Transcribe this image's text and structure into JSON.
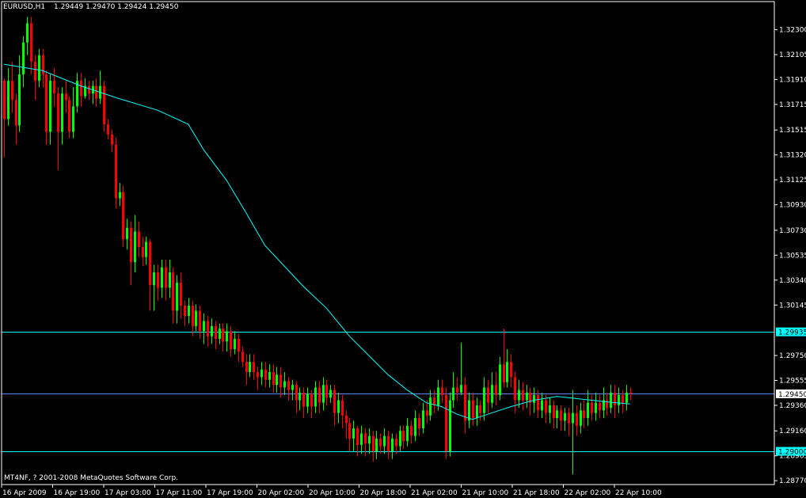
{
  "header": {
    "symbol": "EURUSD,H1",
    "ohlc": "1.29449 1.29470 1.29424 1.29450"
  },
  "footer": {
    "copyright": "MT4NF, ? 2001-2008 MetaQuotes Software Corp."
  },
  "colors": {
    "background": "#000000",
    "frame": "#ffffff",
    "bull": "#00ff00",
    "bear": "#ff0000",
    "ma": "#00ffff",
    "level_line": "#00ffff",
    "bid_line": "#5f7fff"
  },
  "chart_data": {
    "type": "candlestick",
    "symbol": "EURUSD",
    "timeframe": "H1",
    "ylim": [
      1.2874,
      1.3252
    ],
    "y_ticks": [
      "1.32300",
      "1.32105",
      "1.31910",
      "1.31715",
      "1.31515",
      "1.31320",
      "1.31125",
      "1.30930",
      "1.30730",
      "1.30535",
      "1.30340",
      "1.30145",
      "1.29935",
      "1.29750",
      "1.29555",
      "1.29450",
      "1.29360",
      "1.29160",
      "1.29000",
      "1.28965",
      "1.28770"
    ],
    "x_ticks": [
      "16 Apr 2009",
      "16 Apr 19:00",
      "17 Apr 03:00",
      "17 Apr 11:00",
      "17 Apr 19:00",
      "20 Apr 02:00",
      "20 Apr 10:00",
      "20 Apr 18:00",
      "21 Apr 02:00",
      "21 Apr 10:00",
      "21 Apr 18:00",
      "22 Apr 02:00",
      "22 Apr 10:00"
    ],
    "highlight_levels": [
      {
        "label": "1.29935",
        "value": 1.29935,
        "color": "#00ffff"
      },
      {
        "label": "1.29450",
        "value": 1.2945,
        "color": "#5f7fff"
      },
      {
        "label": "1.29000",
        "value": 1.29,
        "color": "#00ffff"
      }
    ],
    "ma_points": [
      [
        0,
        1.3203
      ],
      [
        10,
        1.3198
      ],
      [
        20,
        1.3186
      ],
      [
        30,
        1.3176
      ],
      [
        40,
        1.3167
      ],
      [
        48,
        1.3156
      ],
      [
        52,
        1.3136
      ],
      [
        58,
        1.3112
      ],
      [
        63,
        1.3087
      ],
      [
        68,
        1.3061
      ],
      [
        73,
        1.3045
      ],
      [
        78,
        1.3029
      ],
      [
        84,
        1.3012
      ],
      [
        90,
        1.299
      ],
      [
        95,
        1.2975
      ],
      [
        100,
        1.296
      ],
      [
        105,
        1.2948
      ],
      [
        110,
        1.2938
      ],
      [
        114,
        1.2935
      ],
      [
        118,
        1.2929
      ],
      [
        122,
        1.2925
      ],
      [
        126,
        1.2929
      ],
      [
        132,
        1.2935
      ],
      [
        138,
        1.294
      ],
      [
        144,
        1.2943
      ],
      [
        150,
        1.2941
      ],
      [
        156,
        1.2939
      ],
      [
        163,
        1.2937
      ]
    ],
    "candles": [
      [
        1.319,
        1.316,
        1.3192,
        1.313
      ],
      [
        1.316,
        1.319,
        1.32,
        1.3155
      ],
      [
        1.319,
        1.3175,
        1.3205,
        1.3165
      ],
      [
        1.3175,
        1.3155,
        1.318,
        1.314
      ],
      [
        1.3155,
        1.3195,
        1.321,
        1.315
      ],
      [
        1.3195,
        1.322,
        1.3225,
        1.3185
      ],
      [
        1.322,
        1.3235,
        1.324,
        1.321
      ],
      [
        1.3235,
        1.3205,
        1.324,
        1.3195
      ],
      [
        1.3205,
        1.319,
        1.321,
        1.3175
      ],
      [
        1.319,
        1.321,
        1.3215,
        1.3185
      ],
      [
        1.321,
        1.3195,
        1.3215,
        1.3185
      ],
      [
        1.3195,
        1.315,
        1.3198,
        1.314
      ],
      [
        1.315,
        1.319,
        1.3195,
        1.314
      ],
      [
        1.319,
        1.318,
        1.32,
        1.317
      ],
      [
        1.318,
        1.315,
        1.3185,
        1.312
      ],
      [
        1.315,
        1.318,
        1.3185,
        1.314
      ],
      [
        1.318,
        1.3175,
        1.319,
        1.3165
      ],
      [
        1.3175,
        1.315,
        1.3178,
        1.3145
      ],
      [
        1.315,
        1.317,
        1.3185,
        1.3145
      ],
      [
        1.317,
        1.319,
        1.3196,
        1.3165
      ],
      [
        1.319,
        1.3178,
        1.3196,
        1.317
      ],
      [
        1.3178,
        1.3186,
        1.3192,
        1.3176
      ],
      [
        1.3186,
        1.318,
        1.319,
        1.3175
      ],
      [
        1.318,
        1.3186,
        1.319,
        1.3172
      ],
      [
        1.3186,
        1.3176,
        1.3192,
        1.317
      ],
      [
        1.3176,
        1.3186,
        1.3198,
        1.3172
      ],
      [
        1.3186,
        1.3156,
        1.319,
        1.315
      ],
      [
        1.3156,
        1.3148,
        1.316,
        1.3144
      ],
      [
        1.3148,
        1.314,
        1.3152,
        1.3134
      ],
      [
        1.314,
        1.3098,
        1.3145,
        1.309
      ],
      [
        1.3098,
        1.3103,
        1.311,
        1.3092
      ],
      [
        1.3103,
        1.3066,
        1.3108,
        1.306
      ],
      [
        1.3066,
        1.3075,
        1.3082,
        1.3058
      ],
      [
        1.3075,
        1.3048,
        1.308,
        1.303
      ],
      [
        1.3048,
        1.3072,
        1.3085,
        1.304
      ],
      [
        1.3072,
        1.306,
        1.308,
        1.3052
      ],
      [
        1.306,
        1.3052,
        1.3068,
        1.3045
      ],
      [
        1.3052,
        1.3064,
        1.3068,
        1.3046
      ],
      [
        1.3064,
        1.303,
        1.3066,
        1.301
      ],
      [
        1.303,
        1.304,
        1.3046,
        1.301
      ],
      [
        1.304,
        1.3028,
        1.3046,
        1.3018
      ],
      [
        1.3028,
        1.3044,
        1.305,
        1.302
      ],
      [
        1.3044,
        1.3028,
        1.305,
        1.3018
      ],
      [
        1.3028,
        1.304,
        1.305,
        1.302
      ],
      [
        1.304,
        1.301,
        1.3044,
        1.3
      ],
      [
        1.301,
        1.3032,
        1.3038,
        1.3
      ],
      [
        1.3032,
        1.3014,
        1.304,
        1.3004
      ],
      [
        1.3014,
        1.3006,
        1.3018,
        1.2998
      ],
      [
        1.3006,
        1.3014,
        1.302,
        1.3
      ],
      [
        1.3014,
        1.2998,
        1.3018,
        1.299
      ],
      [
        1.2998,
        1.301,
        1.3015,
        1.2994
      ],
      [
        1.301,
        1.2994,
        1.3014,
        1.2988
      ],
      [
        1.2994,
        1.3002,
        1.3008,
        1.2984
      ],
      [
        1.3002,
        1.299,
        1.3006,
        1.2982
      ],
      [
        1.299,
        1.2998,
        1.3004,
        1.2984
      ],
      [
        1.2998,
        1.2988,
        1.3002,
        1.298
      ],
      [
        1.2988,
        1.2996,
        1.3,
        1.2984
      ],
      [
        1.2996,
        1.2986,
        1.3,
        1.2978
      ],
      [
        1.2986,
        1.2994,
        1.3,
        1.2978
      ],
      [
        1.2994,
        1.298,
        1.2998,
        1.2974
      ],
      [
        1.298,
        1.2988,
        1.2994,
        1.2976
      ],
      [
        1.2988,
        1.2978,
        1.2992,
        1.297
      ],
      [
        1.2978,
        1.297,
        1.2982,
        1.2966
      ],
      [
        1.297,
        1.2962,
        1.2976,
        1.2952
      ],
      [
        1.2962,
        1.297,
        1.2976,
        1.2958
      ],
      [
        1.297,
        1.2962,
        1.2976,
        1.2956
      ],
      [
        1.2962,
        1.2958,
        1.2966,
        1.2948
      ],
      [
        1.2958,
        1.2964,
        1.297,
        1.2952
      ],
      [
        1.2964,
        1.2956,
        1.297,
        1.295
      ],
      [
        1.2956,
        1.2962,
        1.2968,
        1.295
      ],
      [
        1.2962,
        1.2952,
        1.2968,
        1.2946
      ],
      [
        1.2952,
        1.296,
        1.2966,
        1.2946
      ],
      [
        1.296,
        1.295,
        1.2966,
        1.2942
      ],
      [
        1.295,
        1.2955,
        1.2962,
        1.2944
      ],
      [
        1.2955,
        1.2948,
        1.2958,
        1.294
      ],
      [
        1.2948,
        1.2952,
        1.2956,
        1.294
      ],
      [
        1.2952,
        1.294,
        1.2955,
        1.293
      ],
      [
        1.294,
        1.2946,
        1.295,
        1.2932
      ],
      [
        1.2946,
        1.2935,
        1.295,
        1.2926
      ],
      [
        1.2935,
        1.2945,
        1.295,
        1.293
      ],
      [
        1.2945,
        1.2935,
        1.2948,
        1.2926
      ],
      [
        1.2935,
        1.295,
        1.2955,
        1.293
      ],
      [
        1.295,
        1.2938,
        1.2955,
        1.293
      ],
      [
        1.2938,
        1.2952,
        1.2958,
        1.2932
      ],
      [
        1.2952,
        1.2942,
        1.2956,
        1.2936
      ],
      [
        1.2942,
        1.2948,
        1.2952,
        1.2938
      ],
      [
        1.2948,
        1.293,
        1.2952,
        1.292
      ],
      [
        1.293,
        1.294,
        1.2946,
        1.2922
      ],
      [
        1.294,
        1.2928,
        1.2944,
        1.2918
      ],
      [
        1.2928,
        1.2922,
        1.2932,
        1.291
      ],
      [
        1.2922,
        1.291,
        1.2926,
        1.29
      ],
      [
        1.291,
        1.2918,
        1.2924,
        1.29
      ],
      [
        1.2918,
        1.2905,
        1.292,
        1.2896
      ],
      [
        1.2905,
        1.2914,
        1.292,
        1.2898
      ],
      [
        1.2914,
        1.2906,
        1.2918,
        1.2896
      ],
      [
        1.2906,
        1.2912,
        1.2918,
        1.2898
      ],
      [
        1.2912,
        1.29,
        1.2916,
        1.2892
      ],
      [
        1.29,
        1.291,
        1.2916,
        1.2894
      ],
      [
        1.291,
        1.2904,
        1.2914,
        1.2898
      ],
      [
        1.2904,
        1.2912,
        1.2918,
        1.2898
      ],
      [
        1.2912,
        1.29,
        1.2916,
        1.2894
      ],
      [
        1.29,
        1.291,
        1.2914,
        1.2894
      ],
      [
        1.291,
        1.2904,
        1.2914,
        1.2898
      ],
      [
        1.2904,
        1.2916,
        1.292,
        1.29
      ],
      [
        1.2916,
        1.2908,
        1.292,
        1.2902
      ],
      [
        1.2908,
        1.292,
        1.2926,
        1.2904
      ],
      [
        1.292,
        1.2912,
        1.2924,
        1.2906
      ],
      [
        1.2912,
        1.2926,
        1.2932,
        1.2908
      ],
      [
        1.2926,
        1.2918,
        1.293,
        1.2912
      ],
      [
        1.2918,
        1.2932,
        1.2938,
        1.2914
      ],
      [
        1.2932,
        1.2928,
        1.294,
        1.2922
      ],
      [
        1.2928,
        1.2942,
        1.2948,
        1.2924
      ],
      [
        1.2942,
        1.2936,
        1.2948,
        1.293
      ],
      [
        1.2936,
        1.295,
        1.2956,
        1.2932
      ],
      [
        1.295,
        1.2944,
        1.2956,
        1.2938
      ],
      [
        1.2944,
        1.29,
        1.295,
        1.2894
      ],
      [
        1.29,
        1.294,
        1.2946,
        1.2896
      ],
      [
        1.294,
        1.295,
        1.2962,
        1.2934
      ],
      [
        1.295,
        1.2946,
        1.2958,
        1.294
      ],
      [
        1.2946,
        1.2952,
        1.2985,
        1.2944
      ],
      [
        1.2952,
        1.2924,
        1.2958,
        1.2914
      ],
      [
        1.2924,
        1.294,
        1.2946,
        1.2918
      ],
      [
        1.294,
        1.2926,
        1.2946,
        1.292
      ],
      [
        1.2926,
        1.2936,
        1.2942,
        1.292
      ],
      [
        1.2936,
        1.293,
        1.294,
        1.2924
      ],
      [
        1.293,
        1.295,
        1.2958,
        1.2924
      ],
      [
        1.295,
        1.2938,
        1.2956,
        1.293
      ],
      [
        1.2938,
        1.2952,
        1.2962,
        1.2934
      ],
      [
        1.2952,
        1.2944,
        1.2962,
        1.2936
      ],
      [
        1.2944,
        1.2968,
        1.2974,
        1.294
      ],
      [
        1.2968,
        1.2954,
        1.2996,
        1.295
      ],
      [
        1.2954,
        1.297,
        1.298,
        1.295
      ],
      [
        1.297,
        1.2958,
        1.2976,
        1.295
      ],
      [
        1.2958,
        1.294,
        1.2962,
        1.293
      ],
      [
        1.294,
        1.2948,
        1.2956,
        1.2934
      ],
      [
        1.2948,
        1.294,
        1.2954,
        1.2932
      ],
      [
        1.294,
        1.2946,
        1.2952,
        1.2934
      ],
      [
        1.2946,
        1.2938,
        1.295,
        1.2928
      ],
      [
        1.2938,
        1.2944,
        1.295,
        1.293
      ],
      [
        1.2944,
        1.2932,
        1.2948,
        1.2926
      ],
      [
        1.2932,
        1.294,
        1.2946,
        1.2926
      ],
      [
        1.294,
        1.293,
        1.2944,
        1.2922
      ],
      [
        1.293,
        1.2936,
        1.2942,
        1.2922
      ],
      [
        1.2936,
        1.2926,
        1.294,
        1.2918
      ],
      [
        1.2926,
        1.2932,
        1.2936,
        1.2918
      ],
      [
        1.2932,
        1.2924,
        1.2936,
        1.2916
      ],
      [
        1.2924,
        1.293,
        1.2934,
        1.2916
      ],
      [
        1.293,
        1.2922,
        1.2934,
        1.2912
      ],
      [
        1.2922,
        1.293,
        1.2948,
        1.2882
      ],
      [
        1.293,
        1.292,
        1.2936,
        1.2912
      ],
      [
        1.292,
        1.2932,
        1.2938,
        1.2914
      ],
      [
        1.2932,
        1.2926,
        1.294,
        1.2918
      ],
      [
        1.2926,
        1.2938,
        1.2948,
        1.292
      ],
      [
        1.2938,
        1.293,
        1.2944,
        1.2924
      ],
      [
        1.293,
        1.2938,
        1.2946,
        1.2924
      ],
      [
        1.2938,
        1.2932,
        1.2944,
        1.2926
      ],
      [
        1.2932,
        1.294,
        1.295,
        1.2926
      ],
      [
        1.294,
        1.2934,
        1.2946,
        1.2928
      ],
      [
        1.2934,
        1.2946,
        1.2952,
        1.293
      ],
      [
        1.2946,
        1.2936,
        1.2952,
        1.2926
      ],
      [
        1.2936,
        1.2944,
        1.295,
        1.293
      ],
      [
        1.2944,
        1.2938,
        1.2948,
        1.293
      ],
      [
        1.2938,
        1.2946,
        1.2952,
        1.2932
      ],
      [
        1.2946,
        1.2945,
        1.295,
        1.294
      ]
    ]
  }
}
